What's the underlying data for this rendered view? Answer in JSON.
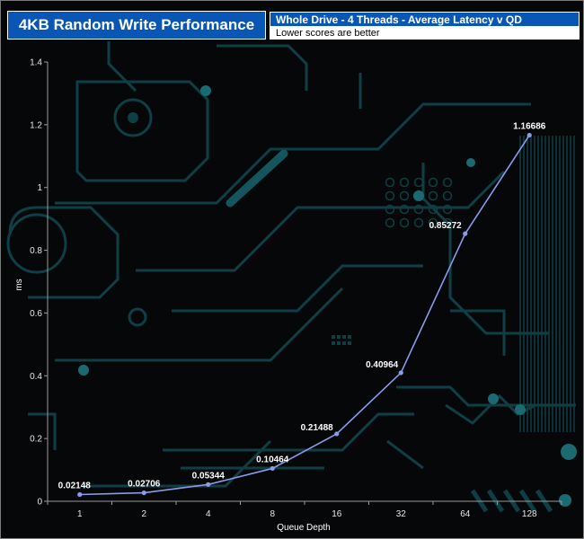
{
  "header": {
    "title": "4KB Random Write Performance",
    "subtitle": "Whole Drive - 4 Threads - Average Latency v QD",
    "note": "Lower scores are better"
  },
  "colors": {
    "title_bg": "#0a56b4",
    "background": "#050708",
    "circuit": "#0f3f45",
    "series_line": "#8c9be8",
    "axis": "#9a9a9a"
  },
  "chart_data": {
    "type": "line",
    "title": "4KB Random Write Performance",
    "subtitle": "Whole Drive - 4 Threads - Average Latency v QD",
    "note": "Lower scores are better",
    "xlabel": "Queue Depth",
    "ylabel": "ms",
    "categories": [
      "1",
      "2",
      "4",
      "8",
      "16",
      "32",
      "64",
      "128"
    ],
    "series": [
      {
        "values": [
          0.02148,
          0.02706,
          0.05344,
          0.10464,
          0.21488,
          0.40964,
          0.85272,
          1.16686
        ]
      }
    ],
    "data_labels": [
      "0.02148",
      "0.02706",
      "0.05344",
      "0.10464",
      "0.21488",
      "0.40964",
      "0.85272",
      "1.16686"
    ],
    "ylim": [
      0,
      1.4
    ],
    "yticks": [
      "0",
      "0.2",
      "0.4",
      "0.6",
      "0.8",
      "1",
      "1.2",
      "1.4"
    ],
    "grid": false,
    "legend": "none"
  }
}
